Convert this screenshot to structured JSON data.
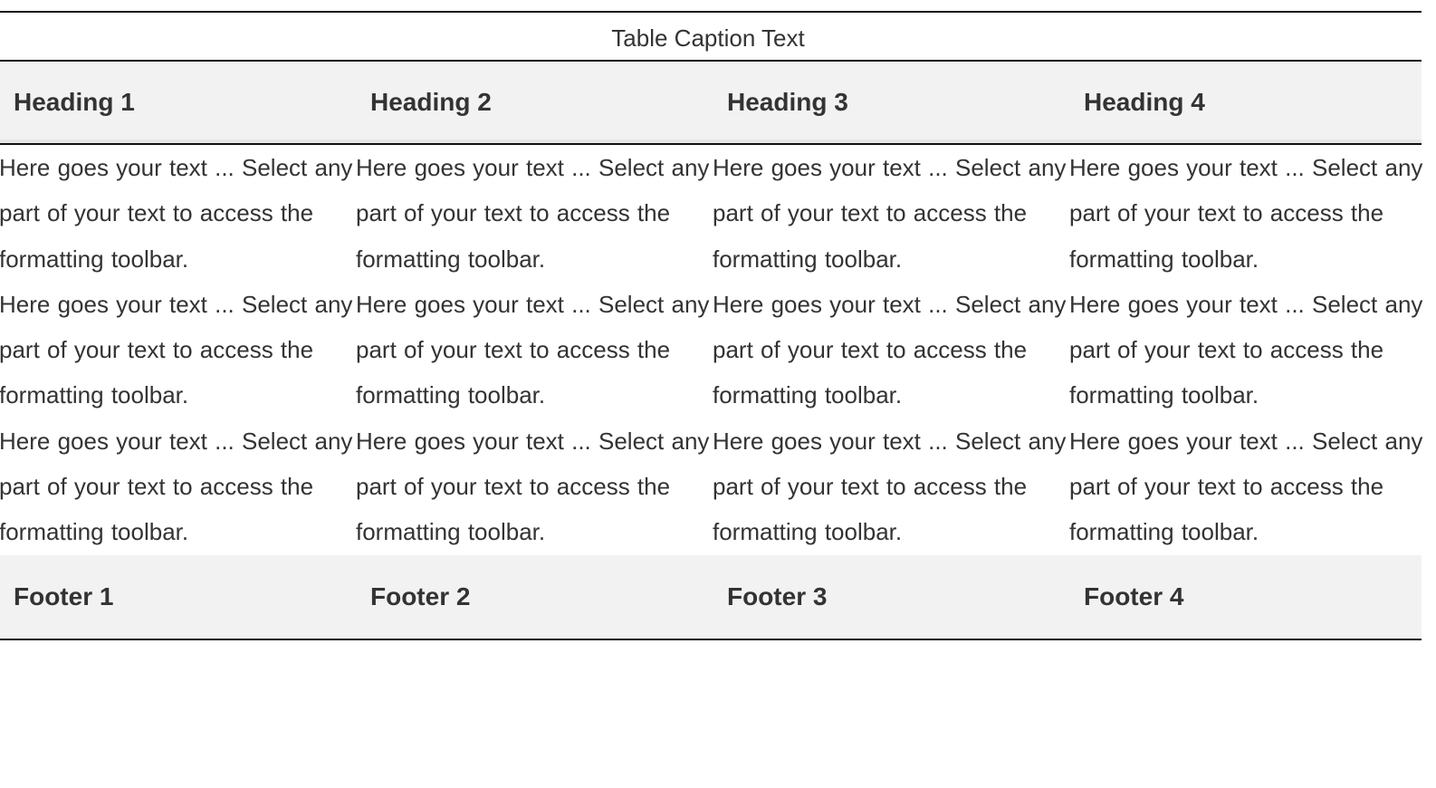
{
  "table": {
    "caption": "Table Caption Text",
    "headers": [
      "Heading 1",
      "Heading 2",
      "Heading 3",
      "Heading 4"
    ],
    "rows": [
      [
        "Here goes your text ... Select any part of your text to access the formatting toolbar.",
        "Here goes your text ... Select any part of your text to access the formatting toolbar.",
        "Here goes your text ... Select any part of your text to access the formatting toolbar.",
        "Here goes your text ... Select any part of your text to access the formatting toolbar."
      ],
      [
        "Here goes your text ... Select any part of your text to access the formatting toolbar.",
        "Here goes your text ... Select any part of your text to access the formatting toolbar.",
        "Here goes your text ... Select any part of your text to access the formatting toolbar.",
        "Here goes your text ... Select any part of your text to access the formatting toolbar."
      ],
      [
        "Here goes your text ... Select any part of your text to access the formatting toolbar.",
        "Here goes your text ... Select any part of your text to access the formatting toolbar.",
        "Here goes your text ... Select any part of your text to access the formatting toolbar.",
        "Here goes your text ... Select any part of your text to access the formatting toolbar."
      ]
    ],
    "footers": [
      "Footer 1",
      "Footer 2",
      "Footer 3",
      "Footer 4"
    ]
  },
  "colors": {
    "header_bg": "#f2f2f2",
    "footer_bg": "#f2f2f2",
    "border": "#111111",
    "text": "#333333"
  }
}
